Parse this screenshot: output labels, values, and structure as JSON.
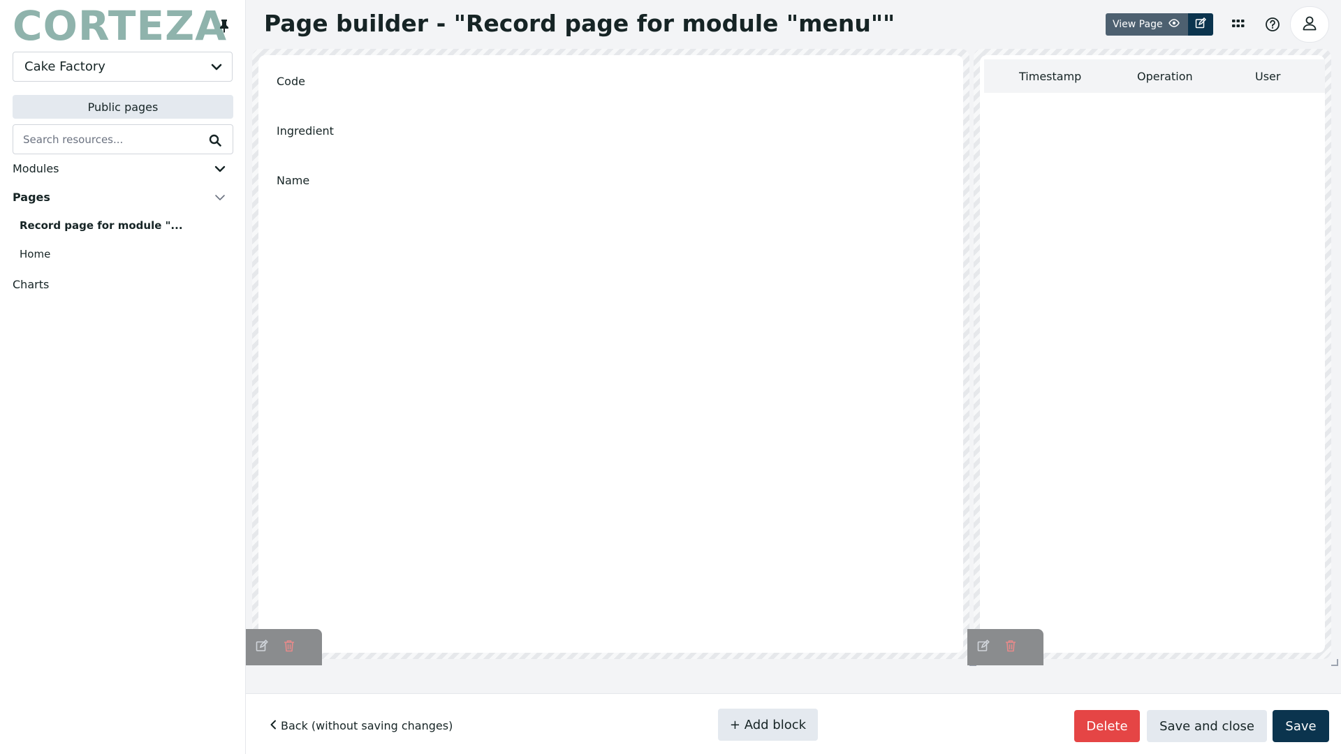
{
  "sidebar": {
    "logo": "CORTEZA",
    "namespace": "Cake Factory",
    "public_pages": "Public pages",
    "search_placeholder": "Search resources...",
    "items": [
      {
        "label": "Modules"
      },
      {
        "label": "Pages"
      },
      {
        "label": "Record page for module \"..."
      },
      {
        "label": "Home"
      },
      {
        "label": "Charts"
      }
    ]
  },
  "header": {
    "title": "Page builder - \"Record page for module \"menu\"\"",
    "view_page": "View Page"
  },
  "blocks": {
    "fields": [
      "Code",
      "Ingredient",
      "Name"
    ],
    "revisions_columns": [
      "Timestamp",
      "Operation",
      "User"
    ]
  },
  "footer": {
    "back": "Back (without saving changes)",
    "add_block": "+ Add block",
    "delete": "Delete",
    "save_and_close": "Save and close",
    "save": "Save"
  },
  "colors": {
    "brand_logo": "#8fb3ac",
    "primary": "#0b344e",
    "danger": "#e54545",
    "secondary_bg": "#e4e9ef"
  }
}
